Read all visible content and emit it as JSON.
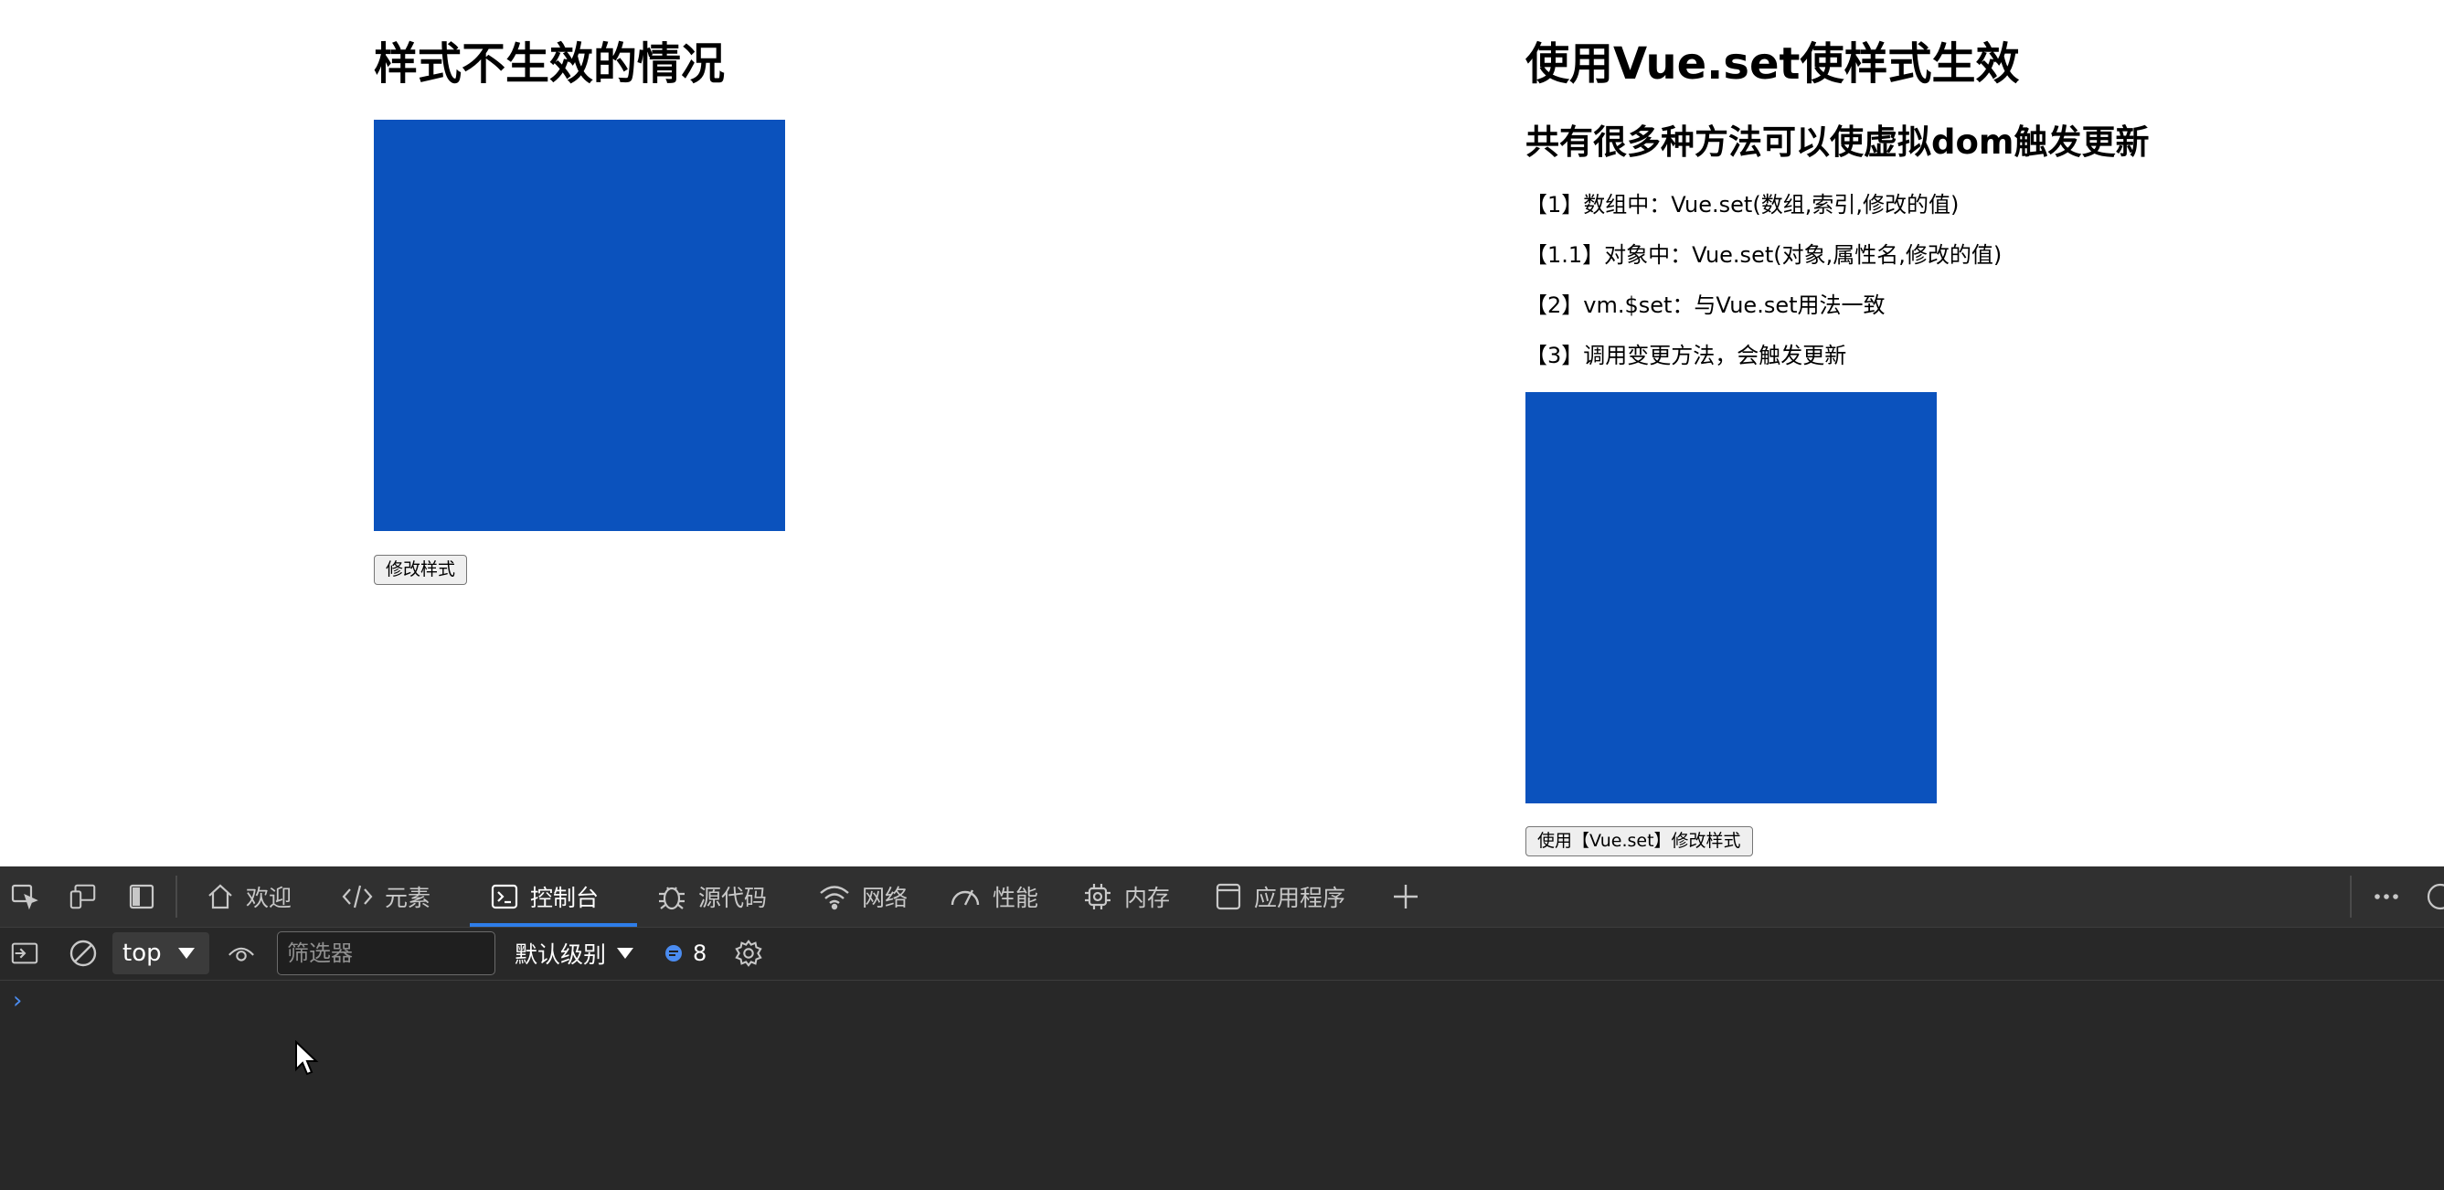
{
  "left": {
    "heading": "样式不生效的情况",
    "button_label": "修改样式"
  },
  "right": {
    "heading": "使用Vue.set使样式生效",
    "subheading": "共有很多种方法可以使虚拟dom触发更新",
    "lines": [
      "【1】数组中：Vue.set(数组,索引,修改的值)",
      "【1.1】对象中：Vue.set(对象,属性名,修改的值)",
      "【2】vm.$set：与Vue.set用法一致",
      "【3】调用变更方法，会触发更新"
    ],
    "button_label": "使用【Vue.set】修改样式"
  },
  "box_color": "#0b52bd",
  "devtools": {
    "tabs": [
      {
        "label": "欢迎",
        "icon": "home-icon"
      },
      {
        "label": "元素",
        "icon": "code-icon"
      },
      {
        "label": "控制台",
        "icon": "console-icon",
        "active": true
      },
      {
        "label": "源代码",
        "icon": "bug-icon"
      },
      {
        "label": "网络",
        "icon": "wifi-icon"
      },
      {
        "label": "性能",
        "icon": "gauge-icon"
      },
      {
        "label": "内存",
        "icon": "chip-icon"
      },
      {
        "label": "应用程序",
        "icon": "app-window-icon"
      }
    ],
    "context": "top",
    "filter_placeholder": "筛选器",
    "levels_label": "默认级别",
    "issues_count": "8",
    "accent_color": "#2e7de9"
  }
}
